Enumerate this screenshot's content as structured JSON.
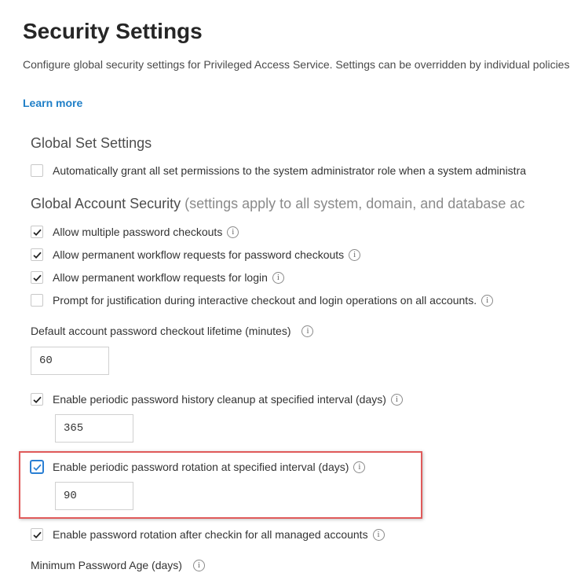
{
  "page": {
    "title": "Security Settings",
    "description": "Configure global security settings for Privileged Access Service. Settings can be overridden by individual policies.",
    "learn_more": "Learn more"
  },
  "global_set": {
    "heading": "Global Set Settings",
    "auto_grant_label": "Automatically grant all set permissions to the system administrator role when a system administra",
    "auto_grant_checked": false
  },
  "global_account": {
    "heading": "Global Account Security",
    "heading_note": "(settings apply to all system, domain, and database ac",
    "options": [
      {
        "label": "Allow multiple password checkouts",
        "checked": true
      },
      {
        "label": "Allow permanent workflow requests for password checkouts",
        "checked": true
      },
      {
        "label": "Allow permanent workflow requests for login",
        "checked": true
      },
      {
        "label": "Prompt for justification during interactive checkout and login operations on all accounts.",
        "checked": false
      }
    ],
    "checkout_lifetime": {
      "label": "Default account password checkout lifetime (minutes)",
      "value": "60"
    },
    "history_cleanup": {
      "label": "Enable periodic password history cleanup at specified interval (days)",
      "checked": true,
      "value": "365"
    },
    "rotation": {
      "label": "Enable periodic password rotation at specified interval (days)",
      "checked": true,
      "value": "90"
    },
    "rotation_after_checkin": {
      "label": "Enable password rotation after checkin for all managed accounts",
      "checked": true
    },
    "min_password_age": {
      "label": "Minimum Password Age (days)"
    }
  },
  "colors": {
    "link": "#1f7fc7",
    "highlight": "#e05a5a",
    "focus": "#2a7fd4"
  },
  "icons": {
    "checkmark": "check-icon",
    "info": "info-icon"
  }
}
